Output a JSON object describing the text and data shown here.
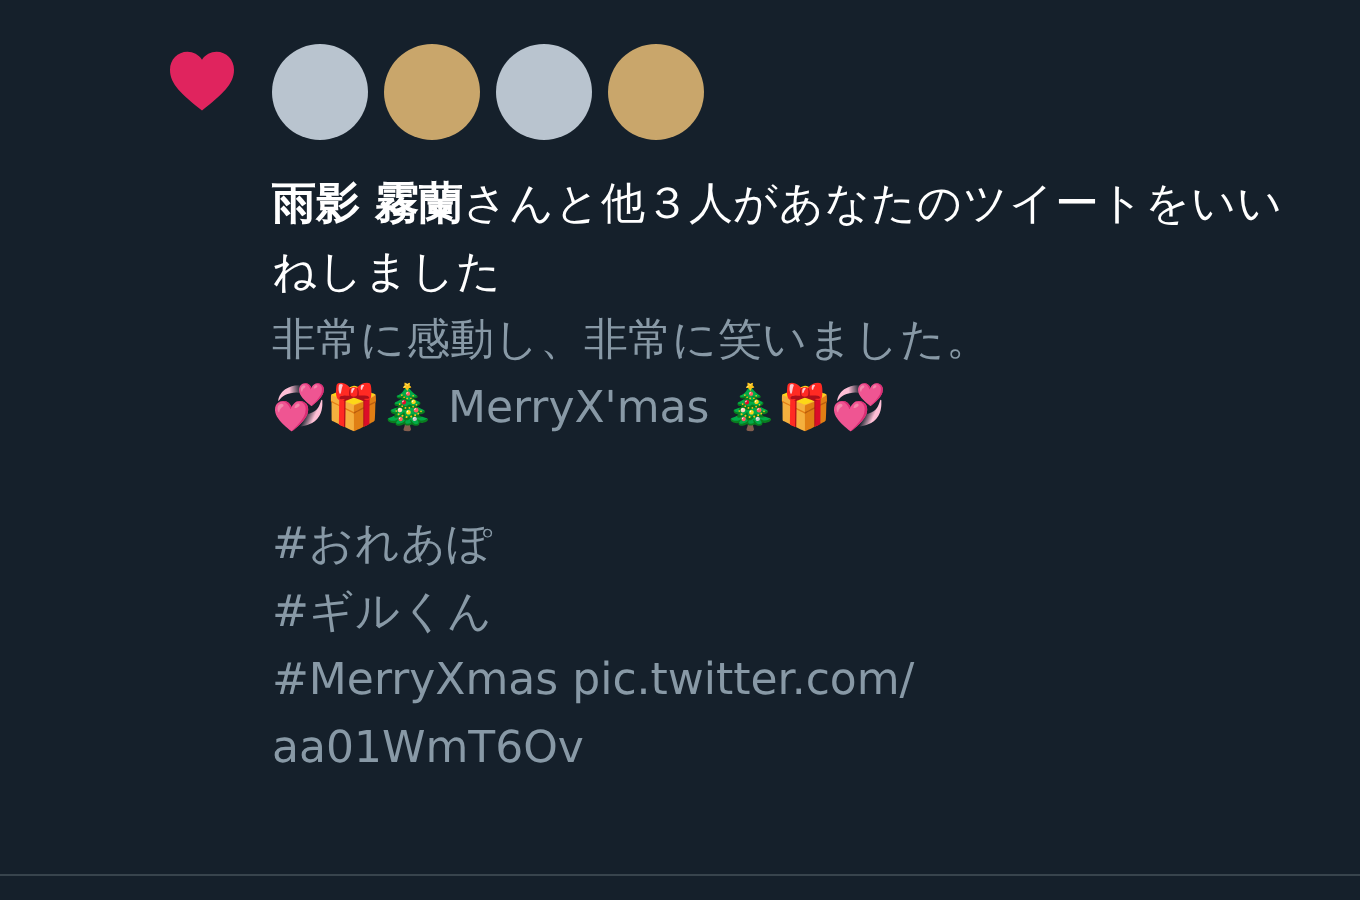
{
  "notification": {
    "avatars": [
      {
        "kind": "photo"
      },
      {
        "kind": "photo"
      },
      {
        "kind": "photo"
      },
      {
        "kind": "photo"
      }
    ],
    "summary": "**雨影 霧蘭**さんと他３人があなたのツイートをいいねしました",
    "tweet_paragraphs": [
      [
        "非常に感動し、非常に笑いました。",
        "💞🎁🎄 MerryX'mas 🎄🎁💞"
      ],
      [
        "#おれあぽ",
        "#ギルくん",
        "#MerryXmas pic.twitter.com/",
        "aa01WmT6Ov"
      ]
    ]
  }
}
